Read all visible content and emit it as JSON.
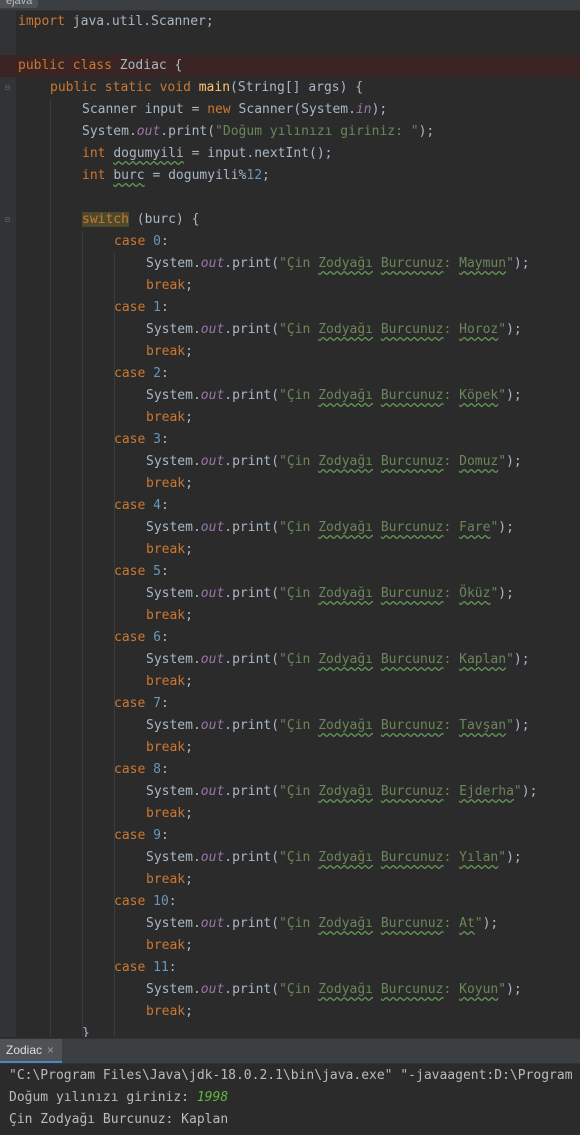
{
  "window": {
    "tab_label": "ejava"
  },
  "colors": {
    "background": "#2b2b2b",
    "keyword": "#cc7832",
    "string": "#6a8759",
    "number": "#6897bb",
    "method": "#ffc66d",
    "static_field": "#9876aa",
    "console_input": "#62b543"
  },
  "editor": {
    "lines": {
      "l1": {
        "kw1": "import",
        "rest": " java.util.Scanner;"
      },
      "l3": {
        "kw1": "public",
        "kw2": "class",
        "rest": " Zodiac {"
      },
      "l4": {
        "kw1": "public",
        "kw2": "static",
        "kw3": "void",
        "fn": "main",
        "rest": "(String[] args) {"
      },
      "l5": {
        "a": "Scanner input = ",
        "kw": "new",
        "b": " Scanner(System.",
        "stat": "in",
        "c": ");"
      },
      "l6": {
        "a": "System.",
        "stat": "out",
        "b": ".print(",
        "str": "\"Doğum yılınızı giriniz: \"",
        "c": ");"
      },
      "l7": {
        "kw": "int",
        "var": "dogumyili",
        "b": " = input.nextInt();"
      },
      "l8": {
        "kw": "int",
        "var": "burc",
        "b": " = dogumyili%",
        "num": "12",
        "c": ";"
      },
      "l10": {
        "kw": "switch",
        "rest": " (burc) {"
      },
      "case_kw": "case",
      "break_kw": "break",
      "print_prefix": "System.",
      "print_out": "out",
      "print_call": ".print(",
      "print_str_open": "\"Çin ",
      "print_word1": "Zodyağı",
      "print_word2": "Burcunuz",
      "print_colon": ": ",
      "print_str_close": "\"",
      "print_end": ");",
      "closing_brace": "}"
    },
    "cases": [
      {
        "n": "0",
        "animal": "Maymun"
      },
      {
        "n": "1",
        "animal": "Horoz"
      },
      {
        "n": "2",
        "animal": "Köpek"
      },
      {
        "n": "3",
        "animal": "Domuz"
      },
      {
        "n": "4",
        "animal": "Fare"
      },
      {
        "n": "5",
        "animal": "Öküz"
      },
      {
        "n": "6",
        "animal": "Kaplan"
      },
      {
        "n": "7",
        "animal": "Tavşan"
      },
      {
        "n": "8",
        "animal": "Ejderha"
      },
      {
        "n": "9",
        "animal": "Yılan"
      },
      {
        "n": "10",
        "animal": "At"
      },
      {
        "n": "11",
        "animal": "Koyun"
      }
    ]
  },
  "run_panel": {
    "tab_label": "Zodiac",
    "close_glyph": "×",
    "console": {
      "command": "\"C:\\Program Files\\Java\\jdk-18.0.2.1\\bin\\java.exe\" \"-javaagent:D:\\Program",
      "prompt": "Doğum yılınızı giriniz: ",
      "user_input": "1998",
      "result": "Çin Zodyağı Burcunuz: Kaplan"
    }
  }
}
